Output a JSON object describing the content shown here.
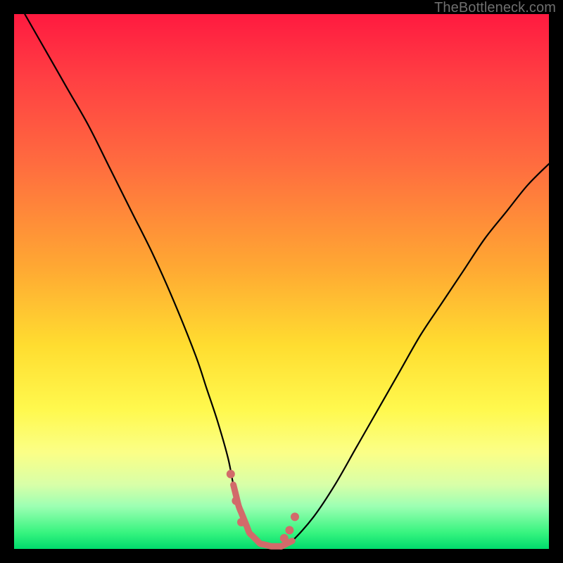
{
  "watermark": {
    "text": "TheBottleneck.com"
  },
  "colors": {
    "black": "#000000",
    "marker": "#d26a6a",
    "gradient_top": "#ff1a40",
    "gradient_bottom": "#00da6c"
  },
  "chart_data": {
    "type": "line",
    "title": "",
    "xlabel": "",
    "ylabel": "",
    "xlim": [
      0,
      100
    ],
    "ylim": [
      0,
      100
    ],
    "grid": false,
    "series": [
      {
        "name": "bottleneck-curve",
        "x": [
          2,
          6,
          10,
          14,
          18,
          22,
          26,
          30,
          34,
          36,
          38,
          40,
          41,
          42,
          44,
          46,
          48,
          50,
          52,
          56,
          60,
          64,
          68,
          72,
          76,
          80,
          84,
          88,
          92,
          96,
          100
        ],
        "y": [
          100,
          93,
          86,
          79,
          71,
          63,
          55,
          46,
          36,
          30,
          24,
          17,
          12,
          8,
          3,
          1,
          0.5,
          0.5,
          1.5,
          6,
          12,
          19,
          26,
          33,
          40,
          46,
          52,
          58,
          63,
          68,
          72
        ]
      }
    ],
    "annotations": {
      "floor_segment": {
        "x_start": 41,
        "x_end": 52
      },
      "markers": [
        {
          "x": 40.5,
          "y": 14
        },
        {
          "x": 41.5,
          "y": 9
        },
        {
          "x": 42.5,
          "y": 5
        },
        {
          "x": 50.5,
          "y": 2
        },
        {
          "x": 51.5,
          "y": 3.5
        },
        {
          "x": 52.5,
          "y": 6
        }
      ]
    }
  }
}
